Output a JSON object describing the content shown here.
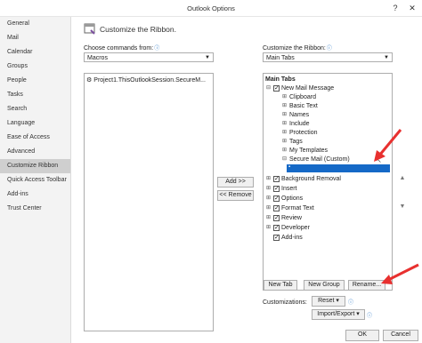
{
  "window": {
    "title": "Outlook Options",
    "help_icon": "help-icon",
    "close_glyph": "✕"
  },
  "sidebar": {
    "items": [
      {
        "label": "General"
      },
      {
        "label": "Mail"
      },
      {
        "label": "Calendar"
      },
      {
        "label": "Groups"
      },
      {
        "label": "People"
      },
      {
        "label": "Tasks"
      },
      {
        "label": "Search"
      },
      {
        "label": "Language"
      },
      {
        "label": "Ease of Access"
      },
      {
        "label": "Advanced"
      },
      {
        "label": "Customize Ribbon"
      },
      {
        "label": "Quick Access Toolbar"
      },
      {
        "label": "Add-ins"
      },
      {
        "label": "Trust Center"
      }
    ],
    "active_index": 10
  },
  "header": {
    "title": "Customize the Ribbon."
  },
  "left": {
    "label": "Choose commands from:",
    "select_value": "Macros",
    "items": [
      {
        "label": "Project1.ThisOutlookSession.SecureM..."
      }
    ]
  },
  "right": {
    "label": "Customize the Ribbon:",
    "select_value": "Main Tabs",
    "tree_header": "Main Tabs",
    "tree": {
      "new_mail_message": "New Mail Message",
      "clipboard": "Clipboard",
      "basic_text": "Basic Text",
      "names": "Names",
      "include": "Include",
      "protection": "Protection",
      "tags": "Tags",
      "my_templates": "My Templates",
      "secure_mail": "Secure Mail (Custom)",
      "new_item": "",
      "background_removal": "Background Removal",
      "insert": "Insert",
      "options": "Options",
      "format_text": "Format Text",
      "review": "Review",
      "developer": "Developer",
      "add_ins": "Add-ins"
    }
  },
  "buttons": {
    "add": "Add >>",
    "remove": "<< Remove",
    "new_tab": "New Tab",
    "new_group": "New Group",
    "rename": "Rename...",
    "reset": "Reset ▾",
    "import_export": "Import/Export ▾",
    "ok": "OK",
    "cancel": "Cancel"
  },
  "customizations_label": "Customizations:",
  "colors": {
    "accent": "#1569c7",
    "annotation": "#e8302f",
    "sidebar_active": "#cfcfcf"
  }
}
